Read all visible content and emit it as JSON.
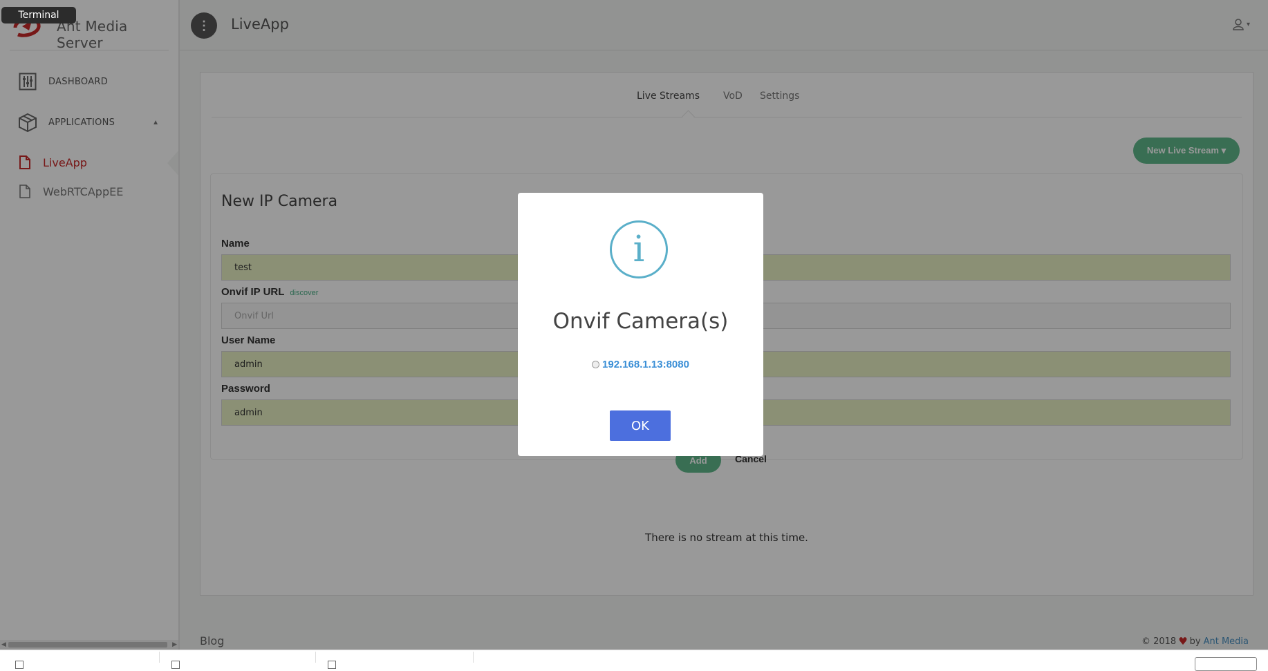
{
  "brand": {
    "name": "Ant Media Server"
  },
  "tooltip": {
    "label": "Terminal"
  },
  "sidebar": {
    "nav": [
      {
        "label": "DASHBOARD",
        "icon": "sliders-icon"
      },
      {
        "label": "APPLICATIONS",
        "icon": "box-icon"
      }
    ],
    "apps": [
      {
        "label": "LiveApp",
        "active": true,
        "icon": "file-icon"
      },
      {
        "label": "WebRTCAppEE",
        "active": false,
        "icon": "file-icon"
      }
    ]
  },
  "header": {
    "title": "LiveApp",
    "menu_icon": "more-vertical-icon",
    "user_icon": "user-icon"
  },
  "tabs": [
    {
      "label": "Live Streams",
      "active": true
    },
    {
      "label": "VoD",
      "active": false
    },
    {
      "label": "Settings",
      "active": false
    }
  ],
  "new_stream_button": {
    "label": "New Live Stream ▾"
  },
  "form": {
    "title": "New IP Camera",
    "name_label": "Name",
    "name_value": "test",
    "onvif_label": "Onvif IP URL",
    "discover_link": "discover",
    "onvif_placeholder": "Onvif Url",
    "user_label": "User Name",
    "user_value": "admin",
    "password_label": "Password",
    "password_value": "admin",
    "add_label": "Add",
    "cancel_label": "Cancel"
  },
  "empty_message": "There is no stream at this time.",
  "footer": {
    "blog": "Blog",
    "copyright": "© 2018",
    "by": "by",
    "company": "Ant Media"
  },
  "modal": {
    "icon": "info-icon",
    "icon_glyph": "i",
    "title": "Onvif Camera(s)",
    "camera_option": "192.168.1.13:8080",
    "ok_label": "OK"
  },
  "colors": {
    "accent_green": "#5fb88a",
    "active_red": "#c62828",
    "ok_blue": "#4c6fde",
    "info_cyan": "#5aafc9",
    "autofill_yellow": "#e8f0c3"
  }
}
